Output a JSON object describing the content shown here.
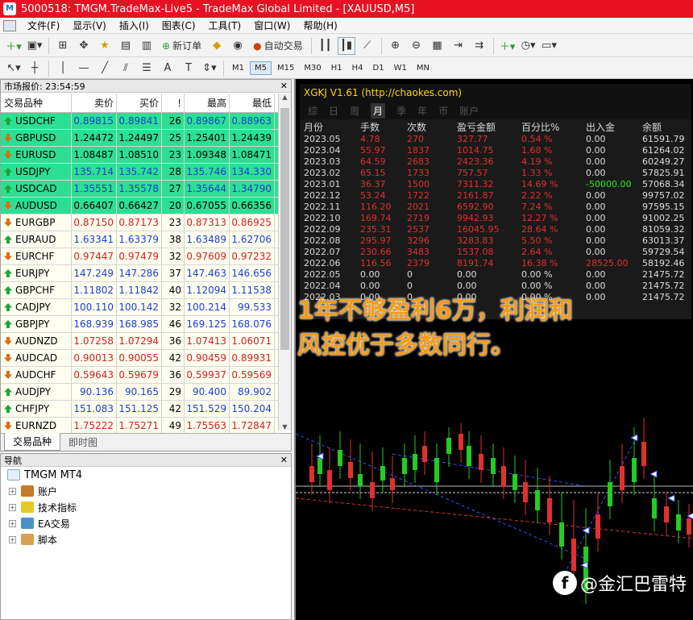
{
  "window": {
    "title": "5000518: TMGM.TradeMax-Live5 - TradeMax Global Limited - [XAUUSD,M5]"
  },
  "menu": [
    "文件(F)",
    "显示(V)",
    "插入(I)",
    "图表(C)",
    "工具(T)",
    "窗口(W)",
    "帮助(H)"
  ],
  "toolbar": {
    "new_order": "新订单",
    "auto_trade": "自动交易"
  },
  "timeframes": [
    "M1",
    "M5",
    "M15",
    "M30",
    "H1",
    "H4",
    "D1",
    "W1",
    "MN"
  ],
  "timeframe_active": "M5",
  "market_watch": {
    "title": "市场报价: 23:54:59",
    "headers": [
      "交易品种",
      "卖价",
      "买价",
      "!",
      "最高",
      "最低"
    ],
    "rows": [
      {
        "symbol": "USDCHF",
        "bid": "0.89815",
        "ask": "0.89841",
        "spread": "26",
        "high": "0.89867",
        "low": "0.88963",
        "dir": "up",
        "bg": "green",
        "color": "blue"
      },
      {
        "symbol": "GBPUSD",
        "bid": "1.24472",
        "ask": "1.24497",
        "spread": "25",
        "high": "1.25401",
        "low": "1.24439",
        "dir": "dn",
        "bg": "green",
        "color": "blk"
      },
      {
        "symbol": "EURUSD",
        "bid": "1.08487",
        "ask": "1.08510",
        "spread": "23",
        "high": "1.09348",
        "low": "1.08471",
        "dir": "dn",
        "bg": "green",
        "color": "blk"
      },
      {
        "symbol": "USDJPY",
        "bid": "135.714",
        "ask": "135.742",
        "spread": "28",
        "high": "135.746",
        "low": "134.330",
        "dir": "up",
        "bg": "green",
        "color": "blue"
      },
      {
        "symbol": "USDCAD",
        "bid": "1.35551",
        "ask": "1.35578",
        "spread": "27",
        "high": "1.35644",
        "low": "1.34790",
        "dir": "up",
        "bg": "green",
        "color": "blue"
      },
      {
        "symbol": "AUDUSD",
        "bid": "0.66407",
        "ask": "0.66427",
        "spread": "20",
        "high": "0.67055",
        "low": "0.66356",
        "dir": "dn",
        "bg": "green",
        "color": "blk"
      },
      {
        "symbol": "EURGBP",
        "bid": "0.87150",
        "ask": "0.87173",
        "spread": "23",
        "high": "0.87313",
        "low": "0.86925",
        "dir": "dn",
        "bg": "cream",
        "color": "red"
      },
      {
        "symbol": "EURAUD",
        "bid": "1.63341",
        "ask": "1.63379",
        "spread": "38",
        "high": "1.63489",
        "low": "1.62706",
        "dir": "up",
        "bg": "cream",
        "color": "blue"
      },
      {
        "symbol": "EURCHF",
        "bid": "0.97447",
        "ask": "0.97479",
        "spread": "32",
        "high": "0.97609",
        "low": "0.97232",
        "dir": "dn",
        "bg": "cream",
        "color": "red"
      },
      {
        "symbol": "EURJPY",
        "bid": "147.249",
        "ask": "147.286",
        "spread": "37",
        "high": "147.463",
        "low": "146.656",
        "dir": "up",
        "bg": "cream",
        "color": "blue"
      },
      {
        "symbol": "GBPCHF",
        "bid": "1.11802",
        "ask": "1.11842",
        "spread": "40",
        "high": "1.12094",
        "low": "1.11538",
        "dir": "up",
        "bg": "cream",
        "color": "blue"
      },
      {
        "symbol": "CADJPY",
        "bid": "100.110",
        "ask": "100.142",
        "spread": "32",
        "high": "100.214",
        "low": "99.533",
        "dir": "up",
        "bg": "cream",
        "color": "blue"
      },
      {
        "symbol": "GBPJPY",
        "bid": "168.939",
        "ask": "168.985",
        "spread": "46",
        "high": "169.125",
        "low": "168.076",
        "dir": "up",
        "bg": "cream",
        "color": "blue"
      },
      {
        "symbol": "AUDNZD",
        "bid": "1.07258",
        "ask": "1.07294",
        "spread": "36",
        "high": "1.07413",
        "low": "1.06071",
        "dir": "dn",
        "bg": "cream",
        "color": "red"
      },
      {
        "symbol": "AUDCAD",
        "bid": "0.90013",
        "ask": "0.90055",
        "spread": "42",
        "high": "0.90459",
        "low": "0.89931",
        "dir": "dn",
        "bg": "cream",
        "color": "red"
      },
      {
        "symbol": "AUDCHF",
        "bid": "0.59643",
        "ask": "0.59679",
        "spread": "36",
        "high": "0.59937",
        "low": "0.59569",
        "dir": "dn",
        "bg": "cream",
        "color": "red"
      },
      {
        "symbol": "AUDJPY",
        "bid": "90.136",
        "ask": "90.165",
        "spread": "29",
        "high": "90.400",
        "low": "89.902",
        "dir": "up",
        "bg": "cream",
        "color": "blue"
      },
      {
        "symbol": "CHFJPY",
        "bid": "151.083",
        "ask": "151.125",
        "spread": "42",
        "high": "151.529",
        "low": "150.204",
        "dir": "up",
        "bg": "cream",
        "color": "blue"
      },
      {
        "symbol": "EURNZD",
        "bid": "1.75222",
        "ask": "1.75271",
        "spread": "49",
        "high": "1.75563",
        "low": "1.72847",
        "dir": "dn",
        "bg": "cream",
        "color": "red"
      }
    ],
    "tabs": [
      "交易品种",
      "即时图"
    ]
  },
  "navigator": {
    "title": "导航",
    "root": "TMGM MT4",
    "items": [
      "账户",
      "技术指标",
      "EA交易",
      "脚本"
    ]
  },
  "stats_panel": {
    "title": "XGKJ V1.61  (http://chaokes.com)",
    "tabs": [
      "综",
      "日",
      "周",
      "月",
      "季",
      "年",
      "币",
      "账户"
    ],
    "active_tab": "月",
    "headers": [
      "月份",
      "手数",
      "次数",
      "盈亏金额",
      "百分比%",
      "出入金",
      "余额"
    ],
    "rows": [
      [
        "2023.05",
        "4.78",
        "270",
        "327.77",
        "0.54 %",
        "0.00",
        "61591.79"
      ],
      [
        "2023.04",
        "55.97",
        "1837",
        "1014.75",
        "1.68 %",
        "0.00",
        "61264.02"
      ],
      [
        "2023.03",
        "64.59",
        "2683",
        "2423.36",
        "4.19 %",
        "0.00",
        "60249.27"
      ],
      [
        "2023.02",
        "65.15",
        "1733",
        "757.57",
        "1.33 %",
        "0.00",
        "57825.91"
      ],
      [
        "2023.01",
        "36.37",
        "1500",
        "7311.32",
        "14.69 %",
        "-50000.00",
        "57068.34"
      ],
      [
        "2022.12",
        "53.24",
        "1722",
        "2161.87",
        "2.22 %",
        "0.00",
        "99757.02"
      ],
      [
        "2022.11",
        "116.20",
        "2021",
        "6592.90",
        "7.24 %",
        "0.00",
        "97595.15"
      ],
      [
        "2022.10",
        "169.74",
        "2719",
        "9942.93",
        "12.27 %",
        "0.00",
        "91002.25"
      ],
      [
        "2022.09",
        "235.31",
        "2537",
        "16045.95",
        "28.64 %",
        "0.00",
        "81059.32"
      ],
      [
        "2022.08",
        "295.97",
        "3296",
        "3283.83",
        "5.50 %",
        "0.00",
        "63013.37"
      ],
      [
        "2022.07",
        "230.66",
        "3483",
        "1537.08",
        "2.64 %",
        "0.00",
        "59729.54"
      ],
      [
        "2022.06",
        "116.56",
        "2379",
        "8191.74",
        "16.38 %",
        "28525.00",
        "58192.46"
      ],
      [
        "2022.05",
        "0.00",
        "0",
        "0.00",
        "0.00 %",
        "0.00",
        "21475.72"
      ],
      [
        "2022.04",
        "0.00",
        "0",
        "0.00",
        "0.00 %",
        "0.00",
        "21475.72"
      ],
      [
        "2022.03",
        "0.00",
        "0",
        "0.00",
        "0.00 %",
        "0.00",
        "21475.72"
      ]
    ]
  },
  "overlay_text": [
    "1年不够盈利6万，利润和",
    "风控优于多数同行。"
  ],
  "watermark": "@金汇巴雷特"
}
